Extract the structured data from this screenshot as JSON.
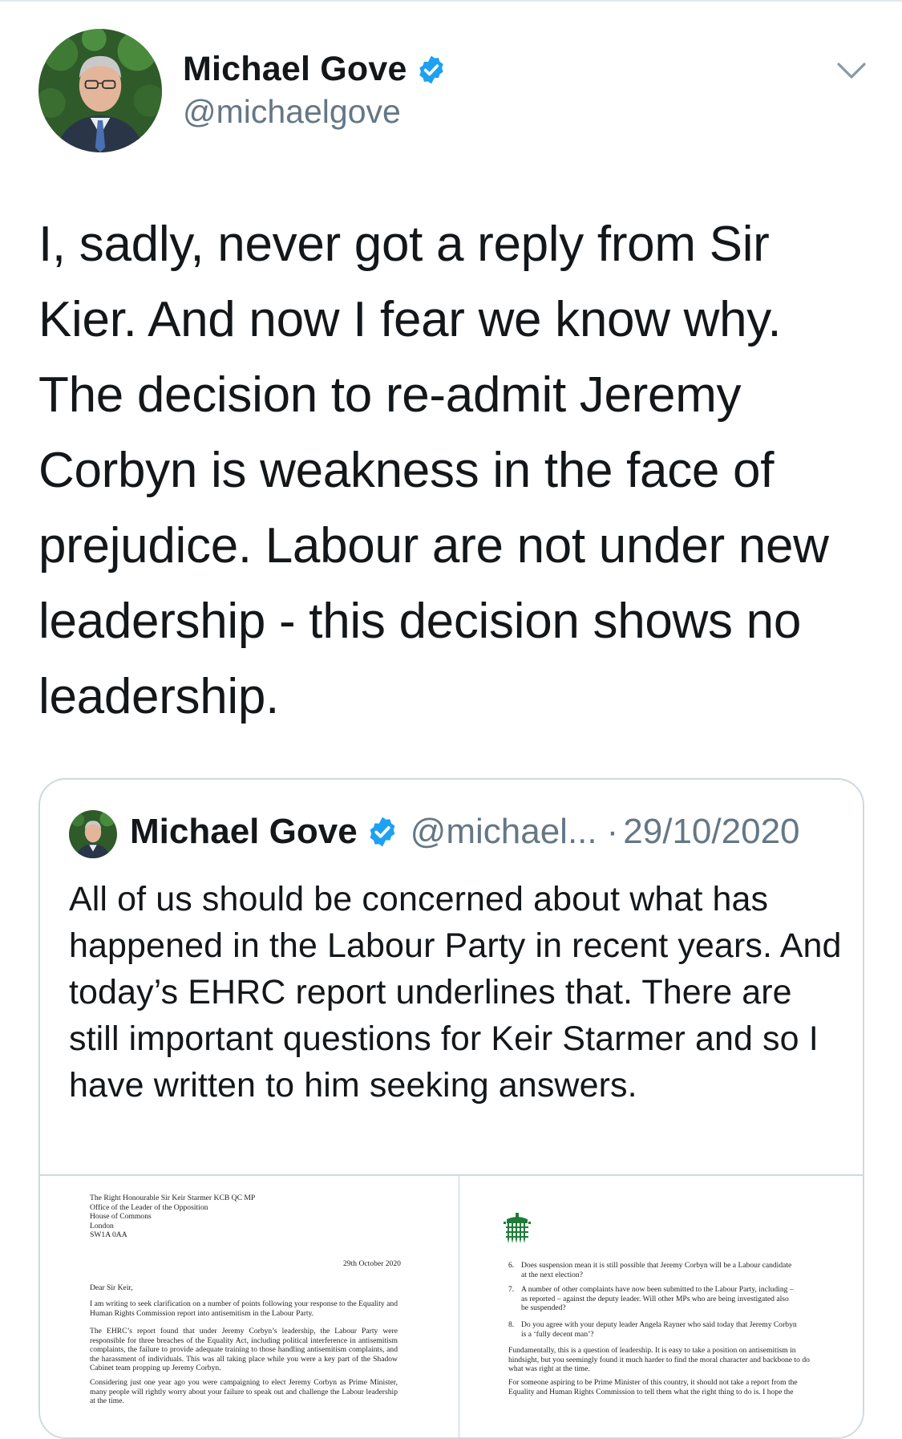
{
  "tweet": {
    "author_name": "Michael Gove",
    "author_handle": "@michaelgove",
    "text": "I, sadly, never got a reply from Sir Kier. And now I fear we know why. The decision to re-admit Jeremy Corbyn is weakness in the face of prejudice. Labour are not under new leadership - this decision shows no leadership."
  },
  "quoted_tweet": {
    "author_name": "Michael Gove",
    "author_handle": "@michael...",
    "separator": "·",
    "date": "29/10/2020",
    "text": "All of us should be concerned about what has happened in the Labour Party in recent years. And today’s EHRC report underlines that. There are still important questions for Keir Starmer and so I have written to him seeking answers."
  },
  "letter_page_1": {
    "address": [
      "The Right Honourable Sir Keir Starmer KCB QC MP",
      "Office of the Leader of the Opposition",
      "House of Commons",
      "London",
      "SW1A 0AA"
    ],
    "date": "29th October 2020",
    "salutation": "Dear Sir Keir,",
    "paragraphs": [
      "I am writing to seek clarification on a number of points following your response to the Equality and Human Rights Commission report into antisemitism in the Labour Party.",
      "The EHRC’s report found that under Jeremy Corbyn’s leadership, the Labour Party were responsible for three breaches of the Equality Act, including political interference in antisemitism complaints, the failure to provide adequate training to those handling antisemitism complaints, and the harassment of individuals. This was all taking place while you were a key part of the Shadow Cabinet team propping up Jeremy Corbyn.",
      "Considering just one year ago you were campaigning to elect Jeremy Corbyn as Prime Minister, many people will rightly worry about your failure to speak out and challenge the Labour leadership at the time."
    ]
  },
  "letter_page_2": {
    "items": [
      {
        "num": "6.",
        "text": "Does suspension mean it is still possible that Jeremy Corbyn will be a Labour candidate at the next election?"
      },
      {
        "num": "7.",
        "text": "A number of other complaints have now been submitted to the Labour Party, including – as reported – against the deputy leader. Will other MPs who are being investigated also be suspended?"
      },
      {
        "num": "8.",
        "text": "Do you agree with your deputy leader Angela Rayner who said today that Jeremy Corbyn is a ‘fully decent man’?"
      }
    ],
    "paragraphs": [
      "Fundamentally, this is a question of leadership. It is easy to take a position on antisemitism in hindsight, but you seemingly found it much harder to find the moral character and backbone to do what was right at the time.",
      "For someone aspiring to be Prime Minister of this country, it should not take a report from the Equality and Human Rights Commission to tell them what the right thing to do is. I hope the"
    ]
  },
  "colors": {
    "text": "#14171a",
    "secondary": "#657786",
    "verified": "#1da1f2",
    "border": "#cfd9de",
    "portcullis": "#1f7a3a"
  },
  "icons": {
    "verified": "verified-badge-icon",
    "menu": "chevron-down-icon",
    "crest": "portcullis-icon"
  }
}
